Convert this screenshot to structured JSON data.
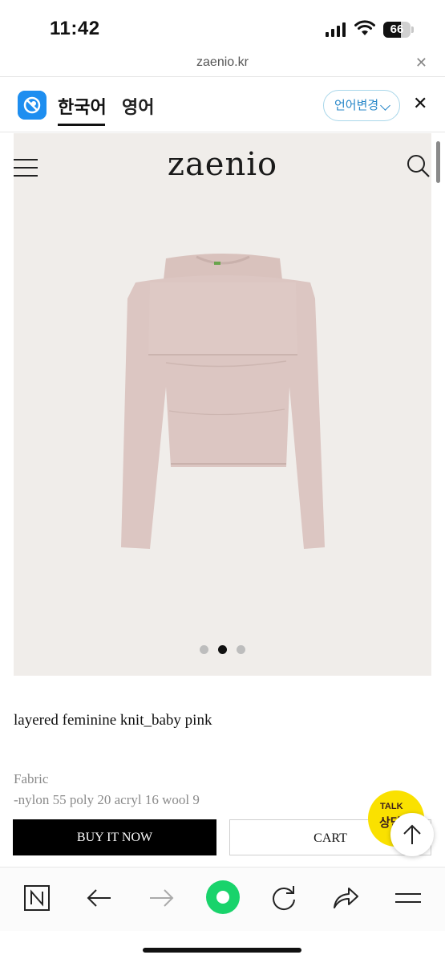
{
  "status": {
    "time": "11:42",
    "battery": "66",
    "battery_level": 0.66
  },
  "browser": {
    "url": "zaenio.kr"
  },
  "translate": {
    "tab_korean": "한국어",
    "tab_english": "영어",
    "change_language": "언어변경"
  },
  "site": {
    "brand": "zaenio"
  },
  "product": {
    "name": "layered feminine knit_baby pink",
    "fabric_label": "Fabric",
    "fabric_value": "-nylon 55 poly 20 acryl 16 wool 9",
    "image_count": 3,
    "active_image_index": 1,
    "color": "#dcc6c2"
  },
  "actions": {
    "buy_now": "BUY IT NOW",
    "cart": "CART"
  },
  "kakao": {
    "bubble": "TALK",
    "label": "상담"
  },
  "colors": {
    "accent": "#2a88c9",
    "kakao": "#fae100",
    "toolbar_green": "#19d36b"
  }
}
